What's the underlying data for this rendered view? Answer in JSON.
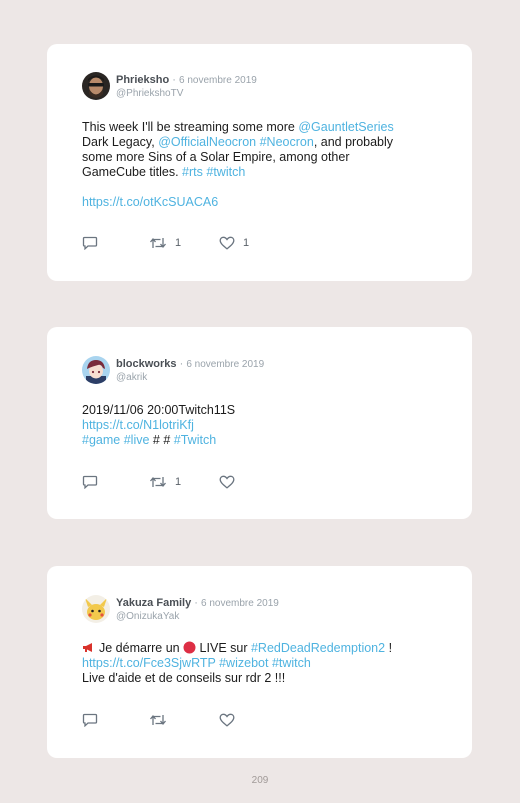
{
  "tweets": [
    {
      "name": "Phrieksho",
      "date": "6 novembre 2019",
      "handle": "@PhriekshoTV",
      "line1": [
        "This week I'll be streaming some more ",
        "@GauntletSeries"
      ],
      "line2": [
        "Dark Legacy, ",
        "@OfficialNeocron",
        " ",
        "#Neocron",
        ", and probably"
      ],
      "line3": "some more Sins of a Solar Empire, among other",
      "line4": [
        "GameCube titles. ",
        "#rts",
        " ",
        "#twitch"
      ],
      "link": "https://t.co/otKcSUACA6",
      "retweets": "1",
      "likes": "1"
    },
    {
      "name": "blockworks",
      "date": "6 novembre 2019",
      "handle": "@akrik",
      "line1": "2019/11/06 20:00Twitch11S",
      "line2": "https://t.co/N1lotriKfj",
      "line3": [
        "#game",
        " ",
        "#live",
        " # # ",
        "#Twitch"
      ],
      "retweets": "1",
      "likes": ""
    },
    {
      "name": "Yakuza Family",
      "date": "6 novembre 2019",
      "handle": "@OnizukaYak",
      "line1": [
        "Je démarre un ",
        " LIVE sur ",
        "#RedDeadRedemption2",
        " !"
      ],
      "line2": [
        "https://t.co/Fce3SjwRTP",
        " ",
        "#wizebot",
        " ",
        "#twitch"
      ],
      "line3": "Live d'aide et de conseils sur rdr 2 !!!",
      "retweets": "",
      "likes": ""
    }
  ],
  "page_number": "209",
  "colors": {
    "background": "#ede7e6",
    "link": "#4fb3e0",
    "card": "#ffffff"
  },
  "icons": [
    "reply-icon",
    "retweet-icon",
    "like-icon",
    "megaphone-icon",
    "red-circle-icon"
  ]
}
